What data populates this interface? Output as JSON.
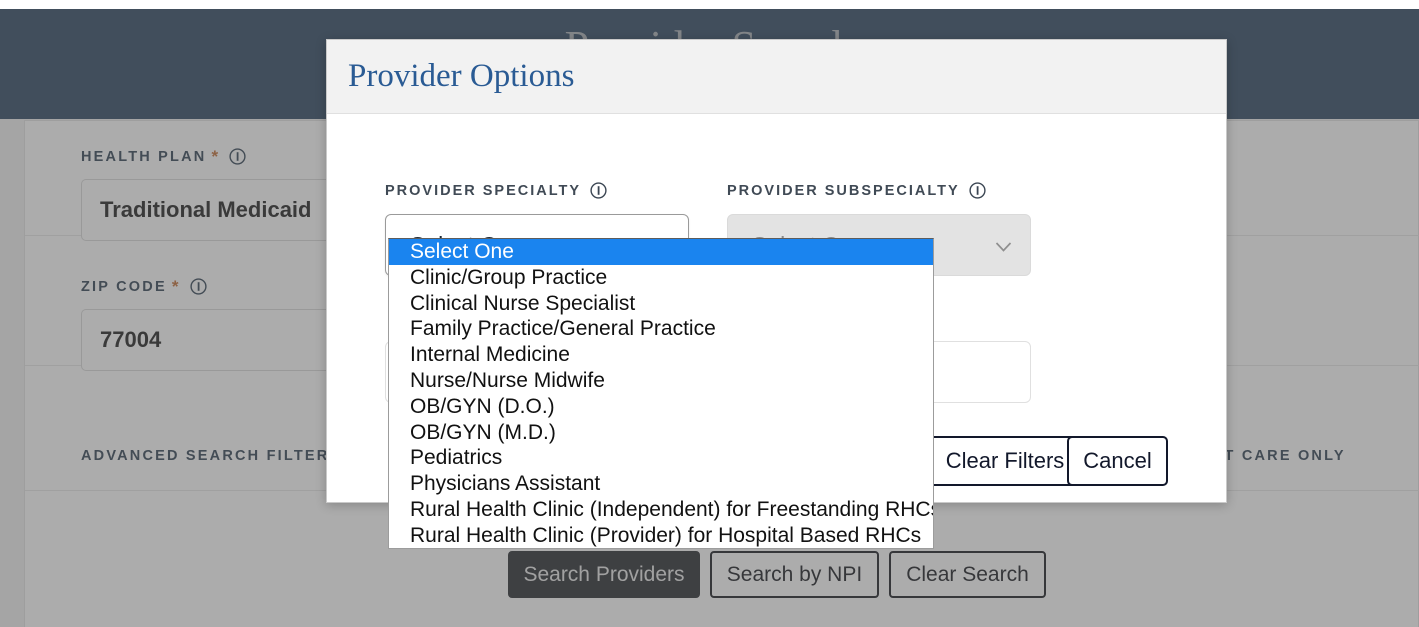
{
  "page": {
    "banner_title": "Provider Search",
    "banner_color": "#173a60",
    "accent_blue": "#2a5b94",
    "highlight_blue": "#1a84ef",
    "required_star": "*",
    "required_star_color": "#c06a30"
  },
  "background_form": {
    "health_plan": {
      "label": "HEALTH PLAN",
      "value": "Traditional Medicaid",
      "info_icon": "info-icon",
      "required": "*"
    },
    "zip_code": {
      "label": "ZIP CODE",
      "value": "77004",
      "info_icon": "info-icon",
      "required": "*"
    },
    "advanced_filters_label": "ADVANCED SEARCH FILTER",
    "urgent_care_label": "ENT CARE ONLY",
    "buttons": [
      {
        "label": "Search Providers",
        "style": "primary"
      },
      {
        "label": "Search by NPI",
        "style": "outline"
      },
      {
        "label": "Clear Search",
        "style": "outline"
      }
    ]
  },
  "modal": {
    "title": "Provider Options",
    "specialty": {
      "label": "PROVIDER SPECIALTY",
      "info_icon": "info-icon",
      "selected": "Select One",
      "caret_icon": "chevron-down-icon",
      "disabled": false
    },
    "subspecialty": {
      "label": "PROVIDER SUBSPECIALTY",
      "info_icon": "info-icon",
      "selected": "Select One",
      "caret_icon": "chevron-down-icon",
      "disabled": true
    },
    "buttons": [
      {
        "label": "Clear Filters"
      },
      {
        "label": "Cancel"
      }
    ]
  },
  "specialty_dropdown": {
    "open": true,
    "selected_index": 0,
    "options": [
      "Select One",
      "Clinic/Group Practice",
      "Clinical Nurse Specialist",
      "Family Practice/General Practice",
      "Internal Medicine",
      "Nurse/Nurse Midwife",
      "OB/GYN (D.O.)",
      "OB/GYN (M.D.)",
      "Pediatrics",
      "Physicians Assistant",
      "Rural Health Clinic (Independent) for Freestanding RHCs",
      "Rural Health Clinic (Provider) for Hospital Based RHCs"
    ]
  }
}
